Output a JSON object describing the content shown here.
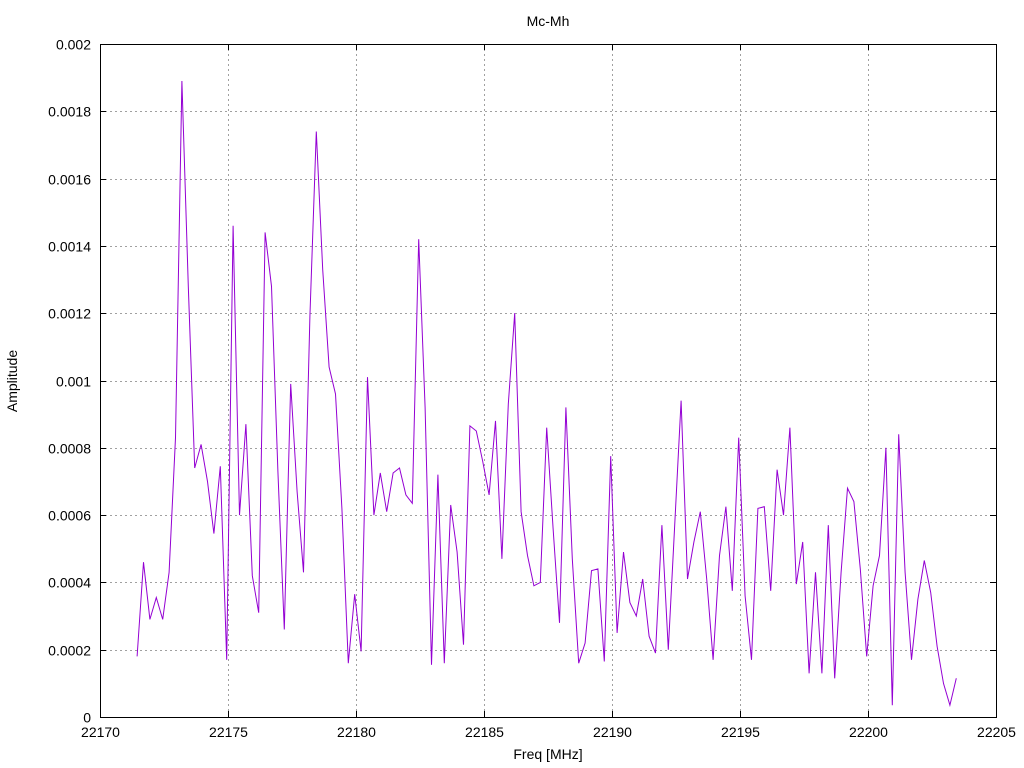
{
  "chart_data": {
    "type": "line",
    "title": "Mc-Mh",
    "xlabel": "Freq [MHz]",
    "ylabel": "Amplitude",
    "xlim": [
      22170,
      22205
    ],
    "ylim": [
      0,
      0.002
    ],
    "xticks": [
      "22170",
      "22175",
      "22180",
      "22185",
      "22190",
      "22195",
      "22200",
      "22205"
    ],
    "yticks": [
      "0",
      "0.0002",
      "0.0004",
      "0.0006",
      "0.0008",
      "0.001",
      "0.0012",
      "0.0014",
      "0.0016",
      "0.0018",
      "0.002"
    ],
    "grid": true,
    "series": [
      {
        "color": "#9400d3",
        "x": [
          22171.45,
          22171.7,
          22171.95,
          22172.2,
          22172.45,
          22172.7,
          22172.95,
          22173.2,
          22173.45,
          22173.7,
          22173.95,
          22174.2,
          22174.45,
          22174.7,
          22174.95,
          22175.2,
          22175.45,
          22175.7,
          22175.95,
          22176.2,
          22176.45,
          22176.7,
          22176.95,
          22177.2,
          22177.45,
          22177.7,
          22177.95,
          22178.2,
          22178.45,
          22178.7,
          22178.95,
          22179.2,
          22179.45,
          22179.7,
          22179.95,
          22180.2,
          22180.45,
          22180.7,
          22180.95,
          22181.2,
          22181.45,
          22181.7,
          22181.95,
          22182.2,
          22182.45,
          22182.7,
          22182.95,
          22183.2,
          22183.45,
          22183.7,
          22183.95,
          22184.2,
          22184.45,
          22184.7,
          22184.95,
          22185.2,
          22185.45,
          22185.7,
          22185.95,
          22186.2,
          22186.45,
          22186.7,
          22186.95,
          22187.2,
          22187.45,
          22187.7,
          22187.95,
          22188.2,
          22188.45,
          22188.7,
          22188.95,
          22189.2,
          22189.45,
          22189.7,
          22189.95,
          22190.2,
          22190.45,
          22190.7,
          22190.95,
          22191.2,
          22191.45,
          22191.7,
          22191.95,
          22192.2,
          22192.45,
          22192.7,
          22192.95,
          22193.2,
          22193.45,
          22193.7,
          22193.95,
          22194.2,
          22194.45,
          22194.7,
          22194.95,
          22195.2,
          22195.45,
          22195.7,
          22195.95,
          22196.2,
          22196.45,
          22196.7,
          22196.95,
          22197.2,
          22197.45,
          22197.7,
          22197.95,
          22198.2,
          22198.45,
          22198.7,
          22198.95,
          22199.2,
          22199.45,
          22199.7,
          22199.95,
          22200.2,
          22200.45,
          22200.7,
          22200.95,
          22201.2,
          22201.45,
          22201.7,
          22201.95,
          22202.2,
          22202.45,
          22202.7,
          22202.95,
          22203.2,
          22203.45
        ],
        "y": [
          0.00018,
          0.00046,
          0.00029,
          0.000355,
          0.00029,
          0.00043,
          0.00083,
          0.00189,
          0.00128,
          0.00074,
          0.00081,
          0.0007,
          0.000545,
          0.000745,
          0.00017,
          0.00146,
          0.0006,
          0.00087,
          0.00042,
          0.00031,
          0.00144,
          0.00128,
          0.00073,
          0.00026,
          0.00099,
          0.00067,
          0.00043,
          0.00119,
          0.00174,
          0.00133,
          0.00104,
          0.00096,
          0.00062,
          0.00016,
          0.000365,
          0.000195,
          0.00101,
          0.0006,
          0.000725,
          0.00061,
          0.000725,
          0.00074,
          0.00066,
          0.000635,
          0.00142,
          0.00092,
          0.000155,
          0.00072,
          0.00016,
          0.00063,
          0.00049,
          0.000215,
          0.000865,
          0.00085,
          0.00076,
          0.00066,
          0.00088,
          0.00047,
          0.00093,
          0.0012,
          0.00061,
          0.00048,
          0.00039,
          0.0004,
          0.00086,
          0.00056,
          0.00028,
          0.00092,
          0.00047,
          0.00016,
          0.00022,
          0.000435,
          0.00044,
          0.000165,
          0.000775,
          0.00025,
          0.00049,
          0.00034,
          0.0003,
          0.00041,
          0.00024,
          0.00019,
          0.00057,
          0.0002,
          0.00057,
          0.00094,
          0.00041,
          0.00052,
          0.00061,
          0.00041,
          0.00017,
          0.00048,
          0.000625,
          0.000375,
          0.00083,
          0.00036,
          0.00017,
          0.00062,
          0.000625,
          0.000375,
          0.000735,
          0.0006,
          0.00086,
          0.000395,
          0.00052,
          0.00013,
          0.00043,
          0.00013,
          0.00057,
          0.000115,
          0.00043,
          0.00068,
          0.00064,
          0.00044,
          0.00018,
          0.00039,
          0.00048,
          0.0008,
          3.5e-05,
          0.00084,
          0.00043,
          0.00017,
          0.00035,
          0.000465,
          0.00037,
          0.00021,
          0.0001,
          3.5e-05,
          0.000115
        ]
      }
    ]
  }
}
